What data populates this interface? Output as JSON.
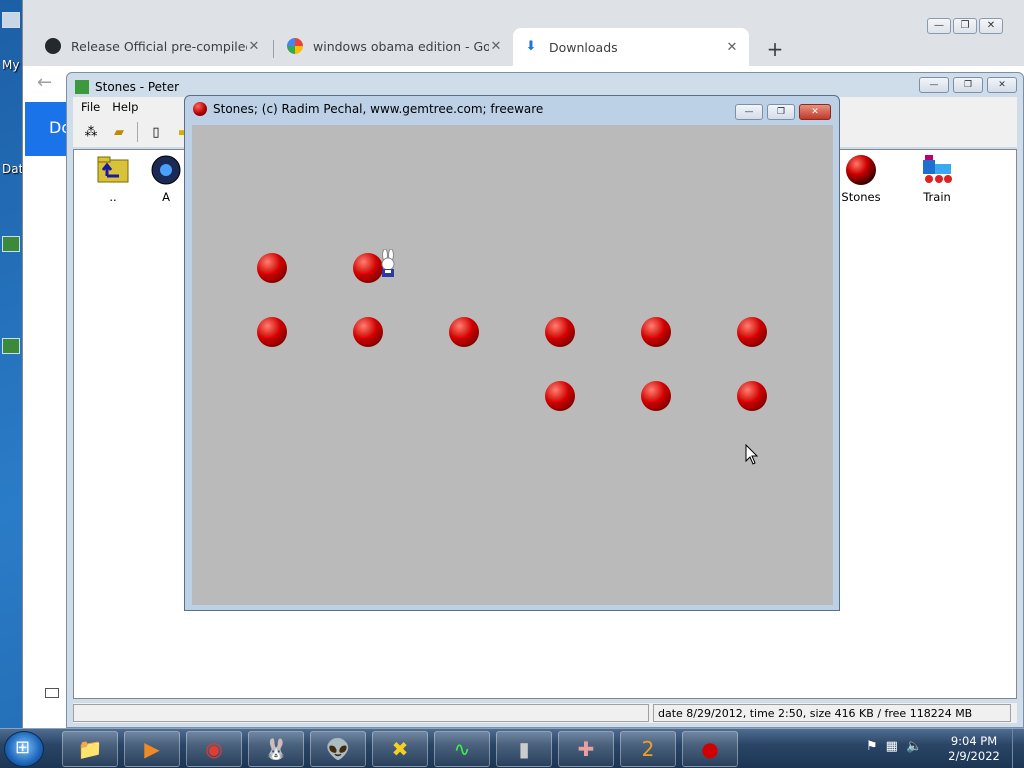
{
  "desktop": {
    "labels": [
      "My",
      "Dat"
    ]
  },
  "browser": {
    "tabs": [
      {
        "title": "Release Official pre-compiled ins",
        "icon": "github-icon",
        "active": false
      },
      {
        "title": "windows obama edition - Google",
        "icon": "google-icon",
        "active": false
      },
      {
        "title": "Downloads",
        "icon": "download-icon",
        "active": true
      }
    ],
    "new_tab_label": "+",
    "page_heading": "Do"
  },
  "explorer": {
    "title": "Stones - Peter",
    "menu": [
      "File",
      "Help"
    ],
    "items": [
      {
        "label": "..",
        "icon": "folder-up-icon"
      },
      {
        "label": "A",
        "icon": "app-icon"
      },
      {
        "label": "Stones",
        "icon": "stone-icon"
      },
      {
        "label": "Train",
        "icon": "train-icon"
      }
    ],
    "status": "date 8/29/2012, time 2:50, size 416 KB / free 118224 MB"
  },
  "game": {
    "title": "Stones;   (c) Radim Pechal, www.gemtree.com;   freeware",
    "stone_color": "#c80000",
    "board_color": "#bababa",
    "grid_rows": 3,
    "grid_cols": 6,
    "stones": [
      {
        "row": 0,
        "col": 0
      },
      {
        "row": 0,
        "col": 1
      },
      {
        "row": 1,
        "col": 0
      },
      {
        "row": 1,
        "col": 1
      },
      {
        "row": 1,
        "col": 2
      },
      {
        "row": 1,
        "col": 3
      },
      {
        "row": 1,
        "col": 4
      },
      {
        "row": 1,
        "col": 5
      },
      {
        "row": 2,
        "col": 3
      },
      {
        "row": 2,
        "col": 4
      },
      {
        "row": 2,
        "col": 5
      }
    ],
    "rabbit_cell": {
      "row": 0,
      "col": 1
    }
  },
  "taskbar": {
    "apps": [
      "explorer-icon",
      "media-player-icon",
      "chrome-icon",
      "rabbit-game-icon",
      "alien-icon",
      "x-game-icon",
      "oscilloscope-icon",
      "cmd-icon",
      "cross-puzzle-icon",
      "number-puzzle-icon",
      "stones-icon"
    ],
    "clock_time": "9:04 PM",
    "clock_date": "2/9/2022"
  }
}
